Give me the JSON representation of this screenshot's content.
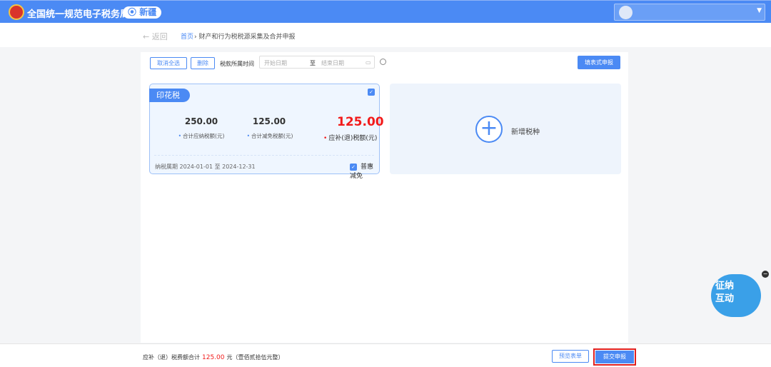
{
  "header": {
    "title": "全国统一规范电子税务局",
    "region": "新疆",
    "logo_icon": "tax-emblem-icon"
  },
  "breadcrumb": {
    "back": "← 返回",
    "home": "首页",
    "separator": "›",
    "current": "财产和行为税税源采集及合并申报"
  },
  "toolbar": {
    "cancel_all": "取消全选",
    "delete": "删除",
    "period_label": "税款所属时间",
    "start_placeholder": "开始日期",
    "to": "至",
    "end_placeholder": "结束日期",
    "fill_form": "填表式申报"
  },
  "card": {
    "tag": "印花税",
    "payable": "250.00",
    "payable_label": "合计应纳税额(元)",
    "relief": "125.00",
    "relief_label": "合计减免税额(元)",
    "due": "125.00",
    "due_label": "应补(退)税额(元)",
    "period": "纳税属期 2024-01-01 至 2024-12-31",
    "preferential": "普惠减免",
    "checked": true
  },
  "add_card": {
    "label": "新增税种"
  },
  "footer": {
    "sum_label": "应补（退）税费额合计",
    "sum_value": "125.00",
    "sum_unit": "元（壹佰贰拾伍元整）",
    "preview": "预览表单",
    "submit": "提交申报"
  },
  "mascot": {
    "text": "征纳互动"
  },
  "colors": {
    "primary": "#4b8af4",
    "red": "#f21b1b"
  }
}
